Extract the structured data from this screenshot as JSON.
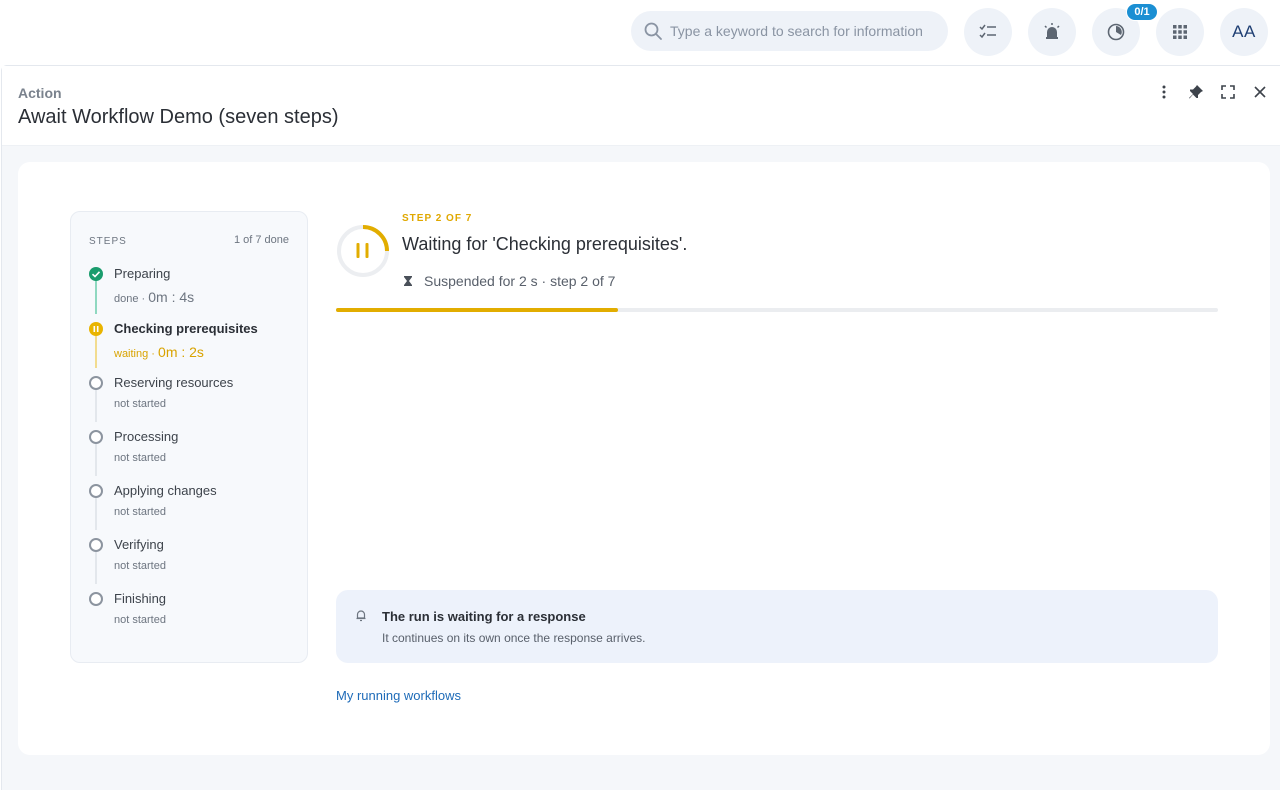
{
  "topbar": {
    "search_placeholder": "Type a keyword to search for information",
    "badge": "0/1",
    "avatar": "AA"
  },
  "panel": {
    "kind": "Action",
    "title": "Await Workflow Demo (seven steps)"
  },
  "steps": {
    "heading": "STEPS",
    "done_count": "1 of 7 done",
    "items": [
      {
        "name": "Preparing",
        "status": "done",
        "duration": "0m : 4s",
        "state": "done"
      },
      {
        "name": "Checking prerequisites",
        "status": "waiting",
        "duration": "0m : 2s",
        "state": "waiting"
      },
      {
        "name": "Reserving resources",
        "status": "not started",
        "state": "todo"
      },
      {
        "name": "Processing",
        "status": "not started",
        "state": "todo"
      },
      {
        "name": "Applying changes",
        "status": "not started",
        "state": "todo"
      },
      {
        "name": "Verifying",
        "status": "not started",
        "state": "todo"
      },
      {
        "name": "Finishing",
        "status": "not started",
        "state": "todo"
      }
    ]
  },
  "main": {
    "step_of": "STEP 2 OF 7",
    "waiting_text": "Waiting for 'Checking prerequisites'.",
    "suspended_text": "Suspended for 2 s · step 2 of 7",
    "progress_fraction": 0.32,
    "ring_fraction": 0.25
  },
  "notice": {
    "title": "The run is waiting for a response",
    "text": "It continues on its own once the response arrives."
  },
  "link": "My running workflows",
  "colors": {
    "accent": "#e2ad00",
    "done": "#1a9c6d",
    "link": "#1e6bb8",
    "badge": "#1b8fd3"
  }
}
